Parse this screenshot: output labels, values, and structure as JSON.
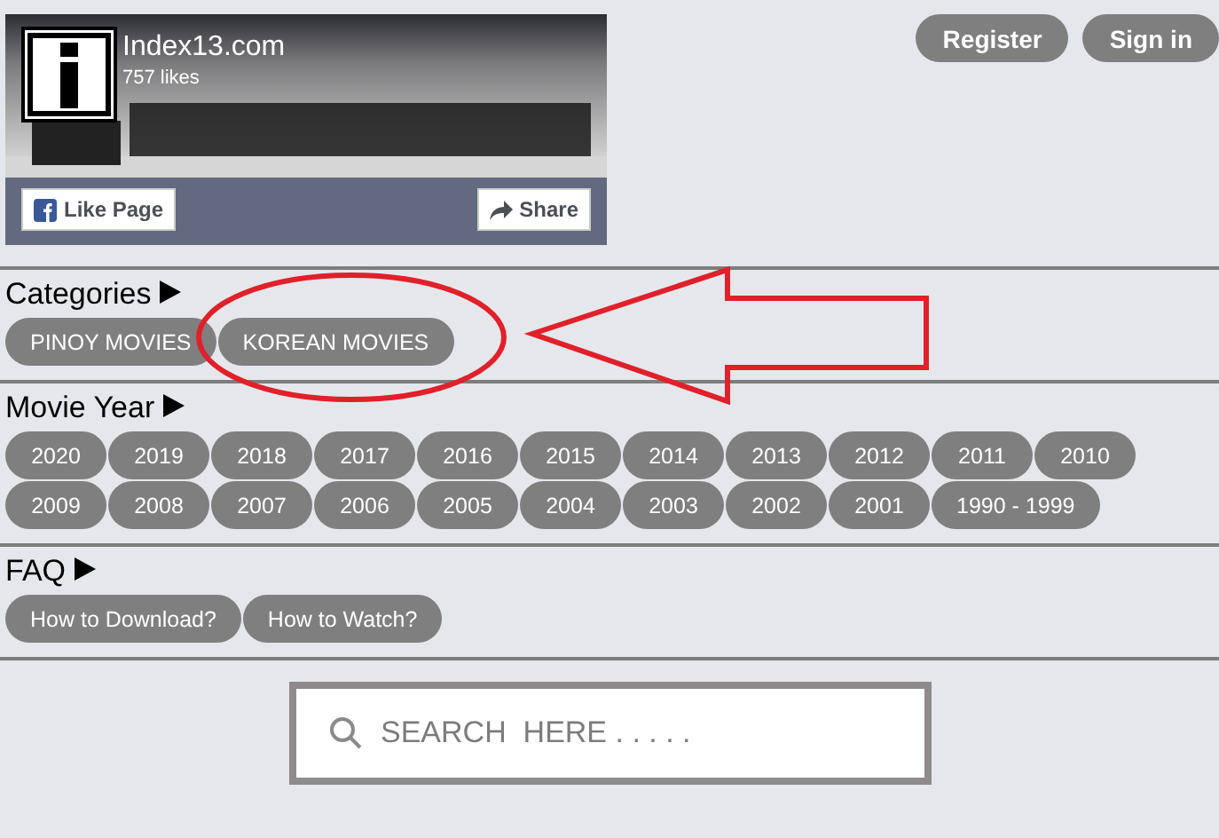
{
  "facebook_widget": {
    "page_name": "Index13.com",
    "likes": "757 likes",
    "like_button": "Like Page",
    "share_button": "Share"
  },
  "header_buttons": [
    "Register",
    "Sign in"
  ],
  "sections": [
    {
      "title": "Categories",
      "items": [
        "PINOY MOVIES",
        "KOREAN MOVIES"
      ]
    },
    {
      "title": "Movie Year",
      "items": [
        "2020",
        "2019",
        "2018",
        "2017",
        "2016",
        "2015",
        "2014",
        "2013",
        "2012",
        "2011",
        "2010",
        "2009",
        "2008",
        "2007",
        "2006",
        "2005",
        "2004",
        "2003",
        "2002",
        "2001",
        "1990 - 1999"
      ]
    },
    {
      "title": "FAQ",
      "items": [
        "How to Download?",
        "How to Watch?"
      ]
    }
  ],
  "search": {
    "placeholder": "SEARCH  HERE . . . . ."
  }
}
